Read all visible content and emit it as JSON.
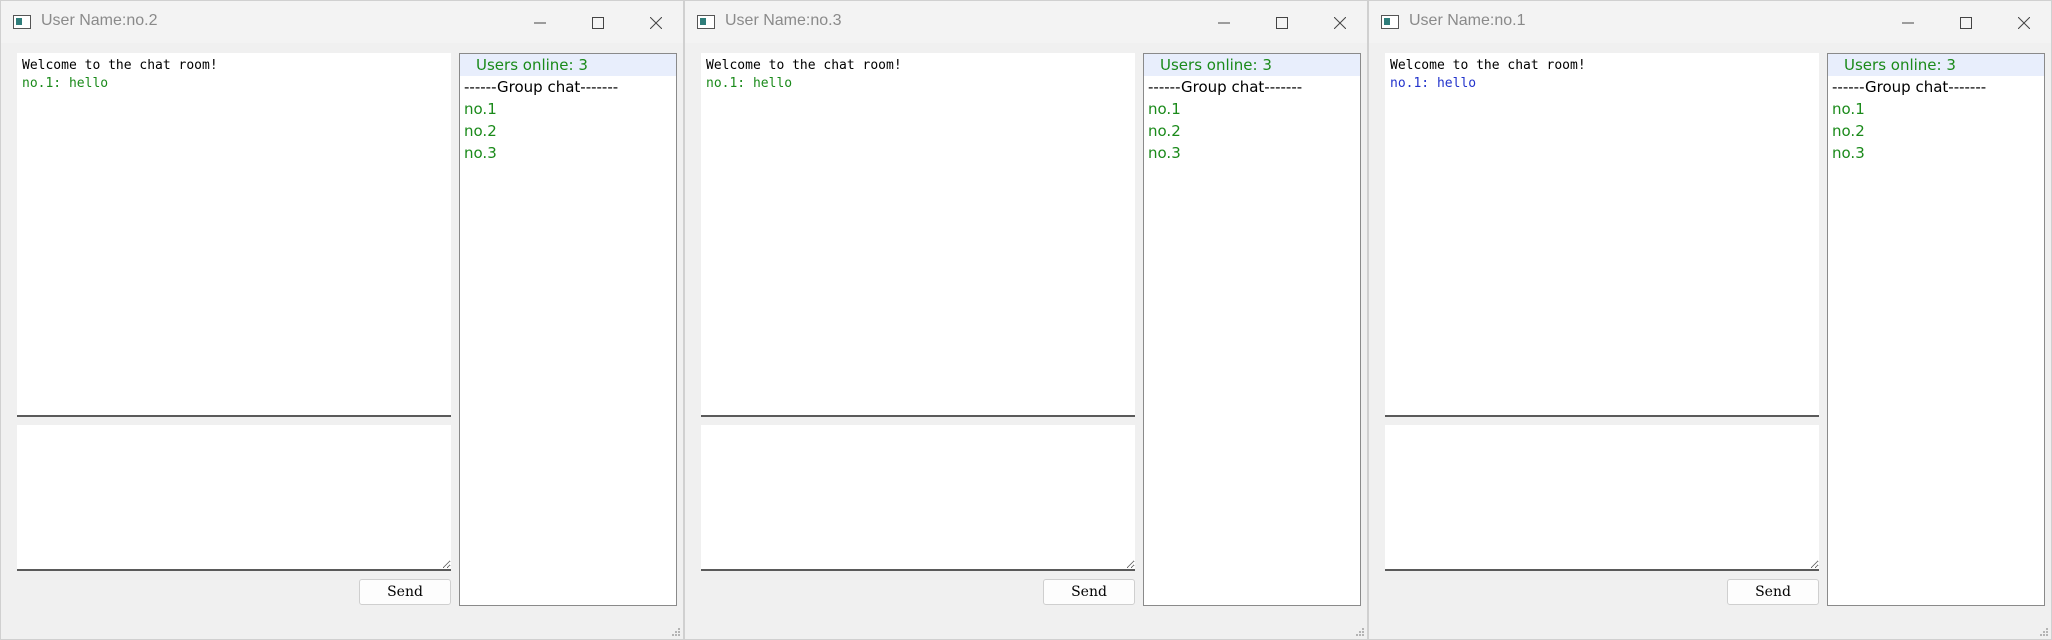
{
  "colors": {
    "online_green": "#1a8a1a",
    "own_message_blue": "#2233cc",
    "header_highlight": "#e8eefc"
  },
  "windows": [
    {
      "title": "User Name:no.2",
      "messages": [
        {
          "text": "Welcome to the chat room!",
          "color": "#000000"
        },
        {
          "text": "no.1: hello",
          "color": "#1a8a1a"
        }
      ],
      "input_value": "",
      "send_label": "Send",
      "online_label": "Users online: 3",
      "group_label": "------Group chat-------",
      "users": [
        "no.1",
        "no.2",
        "no.3"
      ]
    },
    {
      "title": "User Name:no.3",
      "messages": [
        {
          "text": "Welcome to the chat room!",
          "color": "#000000"
        },
        {
          "text": "no.1: hello",
          "color": "#1a8a1a"
        }
      ],
      "input_value": "",
      "send_label": "Send",
      "online_label": "Users online: 3",
      "group_label": "------Group chat-------",
      "users": [
        "no.1",
        "no.2",
        "no.3"
      ]
    },
    {
      "title": "User Name:no.1",
      "messages": [
        {
          "text": "Welcome to the chat room!",
          "color": "#000000"
        },
        {
          "text": "no.1: hello",
          "color": "#2233cc"
        }
      ],
      "input_value": "",
      "send_label": "Send",
      "online_label": "Users online: 3",
      "group_label": "------Group chat-------",
      "users": [
        "no.1",
        "no.2",
        "no.3"
      ]
    }
  ]
}
